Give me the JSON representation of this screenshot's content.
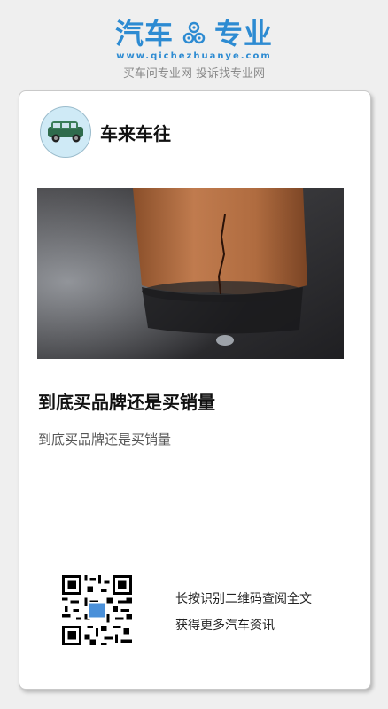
{
  "brand": {
    "name_left": "汽车",
    "name_right": "专业",
    "domain": "www.qichezhuanye.com",
    "slogan": "买车问专业网 投诉找专业网",
    "logo_icon": "gear-icon",
    "color": "#2d8bd2"
  },
  "article": {
    "author": "车来车往",
    "avatar_icon": "car-icon",
    "title": "到底买品牌还是买销量",
    "summary": "到底买品牌还是买销量"
  },
  "footer": {
    "qr_icon": "qr-code-icon",
    "hint_line1": "长按识别二维码查阅全文",
    "hint_line2": "获得更多汽车资讯"
  }
}
